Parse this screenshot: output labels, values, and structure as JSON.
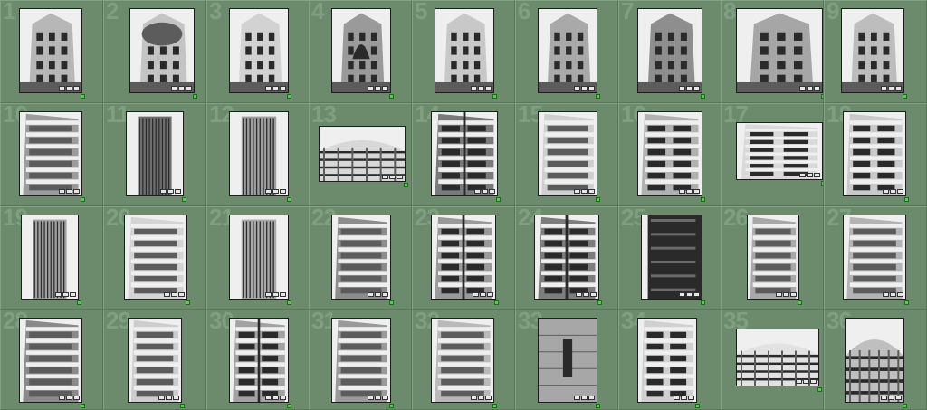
{
  "grid": {
    "cells": [
      {
        "num": "1",
        "kind": "classic",
        "tone": "#b7b7b7"
      },
      {
        "num": "2",
        "kind": "dome",
        "tone": "#c4c4c4"
      },
      {
        "num": "3",
        "kind": "classic",
        "tone": "#d2d2d2"
      },
      {
        "num": "4",
        "kind": "gothic",
        "tone": "#9a9a9a"
      },
      {
        "num": "5",
        "kind": "ornate",
        "tone": "#c8c8c8"
      },
      {
        "num": "6",
        "kind": "ornate",
        "tone": "#a9a9a9"
      },
      {
        "num": "7",
        "kind": "classic",
        "tone": "#8e8e8e"
      },
      {
        "num": "8",
        "kind": "arcade",
        "tone": "#a6a6a6"
      },
      {
        "num": "9",
        "kind": "classic",
        "tone": "#bdbdbd"
      },
      {
        "num": "10",
        "kind": "balconies",
        "tone": "#9c9c9c"
      },
      {
        "num": "11",
        "kind": "glass",
        "tone": "#6f6f6f"
      },
      {
        "num": "12",
        "kind": "fins",
        "tone": "#9e9e9e"
      },
      {
        "num": "13",
        "kind": "curve",
        "tone": "#d8d8d8"
      },
      {
        "num": "14",
        "kind": "corner",
        "tone": "#7a7a7a"
      },
      {
        "num": "15",
        "kind": "stack",
        "tone": "#cfcfcf"
      },
      {
        "num": "16",
        "kind": "grid",
        "tone": "#b1b1b1"
      },
      {
        "num": "17",
        "kind": "grid",
        "tone": "#d9d9d9"
      },
      {
        "num": "18",
        "kind": "grid",
        "tone": "#c9c9c9"
      },
      {
        "num": "19",
        "kind": "tower",
        "tone": "#a0a0a0"
      },
      {
        "num": "20",
        "kind": "stack",
        "tone": "#d4d4d4"
      },
      {
        "num": "21",
        "kind": "fins",
        "tone": "#a9a9a9"
      },
      {
        "num": "22",
        "kind": "balconies",
        "tone": "#8c8c8c"
      },
      {
        "num": "23",
        "kind": "corner",
        "tone": "#9a9a9a"
      },
      {
        "num": "24",
        "kind": "corner",
        "tone": "#7d7d7d"
      },
      {
        "num": "25",
        "kind": "dark",
        "tone": "#6a6a6a"
      },
      {
        "num": "26",
        "kind": "balconies",
        "tone": "#a8a8a8"
      },
      {
        "num": "27",
        "kind": "balconies",
        "tone": "#b3b3b3"
      },
      {
        "num": "28",
        "kind": "balconies",
        "tone": "#8a8a8a"
      },
      {
        "num": "29",
        "kind": "stack",
        "tone": "#cdcdcd"
      },
      {
        "num": "30",
        "kind": "corner",
        "tone": "#a2a2a2"
      },
      {
        "num": "31",
        "kind": "balconies",
        "tone": "#9a9a9a"
      },
      {
        "num": "32",
        "kind": "stack",
        "tone": "#b9b9b9"
      },
      {
        "num": "33",
        "kind": "panel",
        "tone": "#a7a7a7"
      },
      {
        "num": "34",
        "kind": "grid",
        "tone": "#d0d0d0"
      },
      {
        "num": "35",
        "kind": "rotunda",
        "tone": "#e2e2e2"
      },
      {
        "num": "36",
        "kind": "rotunda",
        "tone": "#bfbfbf"
      }
    ]
  }
}
